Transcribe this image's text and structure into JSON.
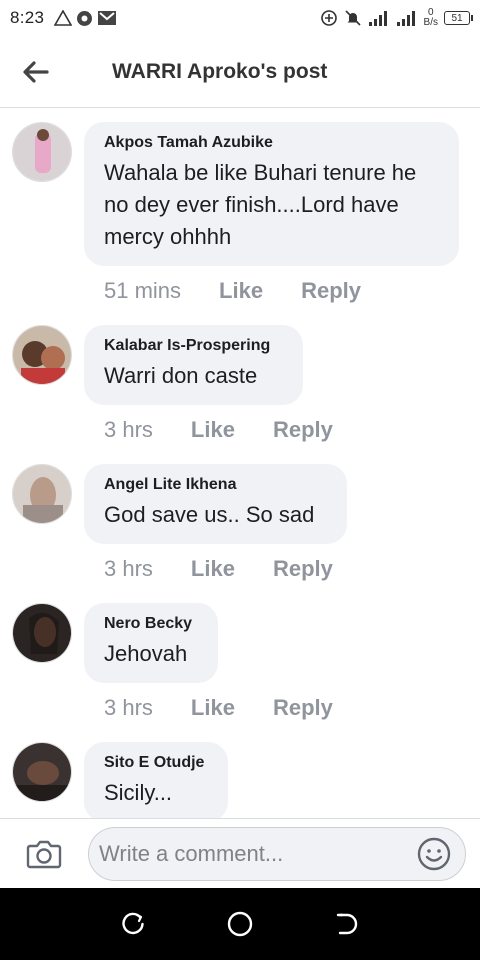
{
  "status": {
    "time": "8:23",
    "net_speed_value": "0",
    "net_speed_unit": "B/s",
    "battery": "51"
  },
  "header": {
    "title": "WARRI Aproko's post"
  },
  "comments": [
    {
      "author": "Akpos Tamah Azubike",
      "text_lines": [
        "Wahala be like Buhari tenure he",
        "no dey ever finish....Lord have",
        "mercy ohhhh"
      ],
      "time": "51 mins",
      "like": "Like",
      "reply": "Reply"
    },
    {
      "author": "Kalabar Is-Prospering",
      "text_lines": [
        "Warri don caste"
      ],
      "time": "3 hrs",
      "like": "Like",
      "reply": "Reply"
    },
    {
      "author": "Angel Lite Ikhena",
      "text_lines": [
        "God save us.. So sad"
      ],
      "time": "3 hrs",
      "like": "Like",
      "reply": "Reply"
    },
    {
      "author": "Nero Becky",
      "text_lines": [
        "Jehovah"
      ],
      "time": "3 hrs",
      "like": "Like",
      "reply": "Reply"
    },
    {
      "author": "Sito E Otudje",
      "text_lines": [
        "Sicily..."
      ]
    }
  ],
  "composer": {
    "placeholder": "Write a comment..."
  },
  "colors": {
    "bubble": "#f0f2f5",
    "meta_text": "#90949c",
    "navbar": "#000000"
  }
}
